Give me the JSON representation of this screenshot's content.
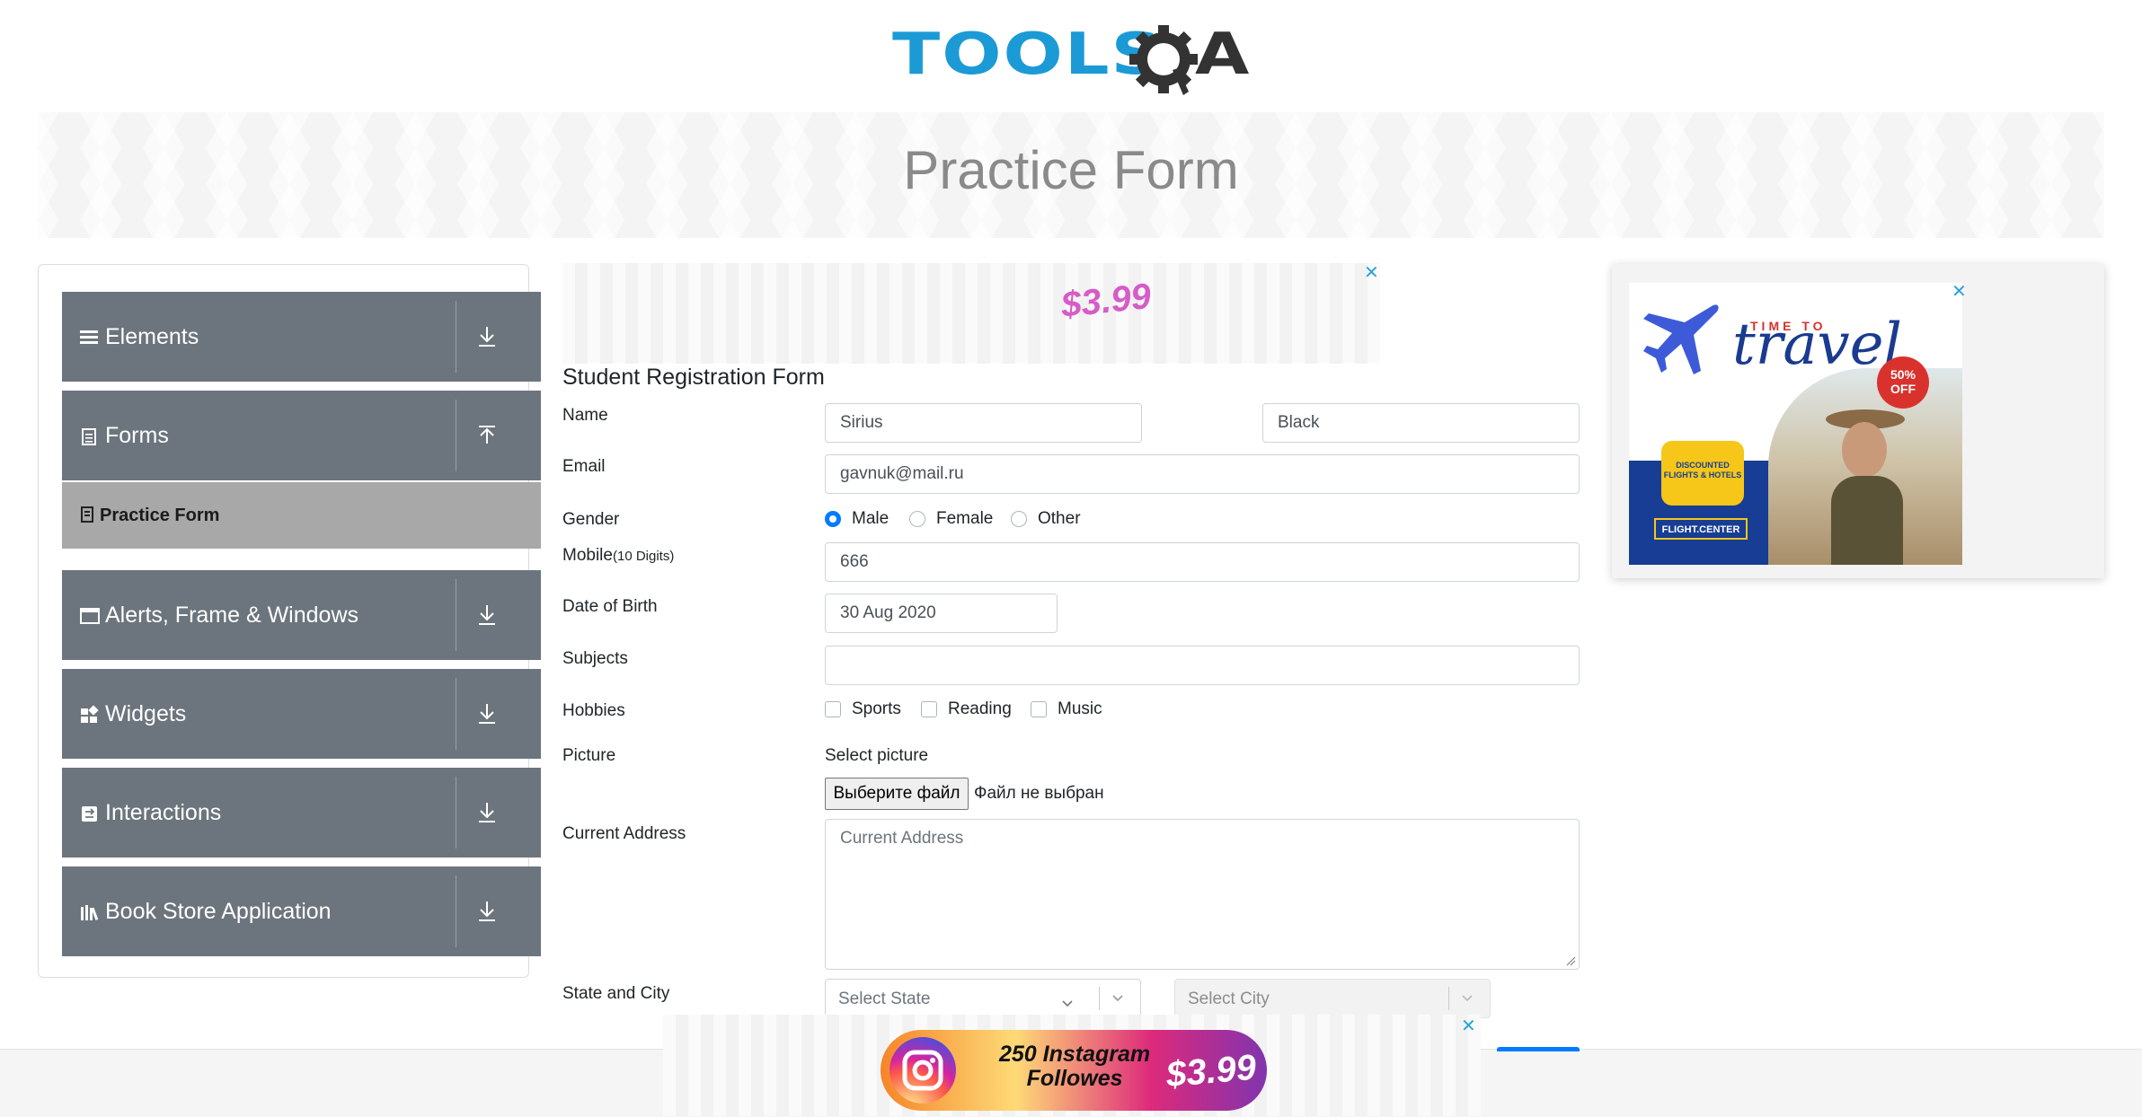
{
  "header": {
    "logo_text": "TOOLS",
    "logo_suffix": "A",
    "page_title": "Practice Form"
  },
  "sidebar": {
    "groups": [
      {
        "label": "Elements",
        "icon": "list-icon",
        "arrow": "download-icon"
      },
      {
        "label": "Forms",
        "icon": "document-icon",
        "arrow": "upload-icon"
      },
      {
        "label": "Alerts, Frame & Windows",
        "icon": "window-icon",
        "arrow": "download-icon"
      },
      {
        "label": "Widgets",
        "icon": "widgets-icon",
        "arrow": "download-icon"
      },
      {
        "label": "Interactions",
        "icon": "interactions-icon",
        "arrow": "download-icon"
      },
      {
        "label": "Book Store Application",
        "icon": "books-icon",
        "arrow": "download-icon"
      }
    ],
    "active_item": {
      "label": "Practice Form",
      "icon": "form-icon"
    }
  },
  "ads": {
    "top_price": "$3.99",
    "close": "✕",
    "bottom_text_line1": "250 Instagram",
    "bottom_text_line2": "Followes",
    "bottom_price": "$3.99",
    "right": {
      "time_to": "TIME TO",
      "travel": "travel",
      "off_line1": "50%",
      "off_line2": "OFF",
      "discount": "DISCOUNTED FLIGHTS & HOTELS",
      "brand": "FLIGHT.CENTER"
    }
  },
  "form": {
    "title": "Student Registration Form",
    "name_label": "Name",
    "first_name": "Sirius",
    "last_name": "Black",
    "email_label": "Email",
    "email": "gavnuk@mail.ru",
    "gender_label": "Gender",
    "gender_options": [
      "Male",
      "Female",
      "Other"
    ],
    "gender_selected": "Male",
    "mobile_label": "Mobile",
    "mobile_hint": "(10 Digits)",
    "mobile": "666",
    "dob_label": "Date of Birth",
    "dob": "30 Aug 2020",
    "subjects_label": "Subjects",
    "subjects": "",
    "hobbies_label": "Hobbies",
    "hobbies": [
      "Sports",
      "Reading",
      "Music"
    ],
    "picture_label": "Picture",
    "select_picture": "Select picture",
    "file_button": "Выберите файл",
    "file_status": "Файл не выбран",
    "address_label": "Current Address",
    "address_placeholder": "Current Address",
    "state_city_label": "State and City",
    "state_placeholder": "Select State",
    "city_placeholder": "Select City"
  },
  "colors": {
    "accent": "#007bff",
    "sidebar_bg": "#6c757d",
    "active_bg": "#a8a8a8",
    "logo_blue": "#1c9ad6"
  }
}
